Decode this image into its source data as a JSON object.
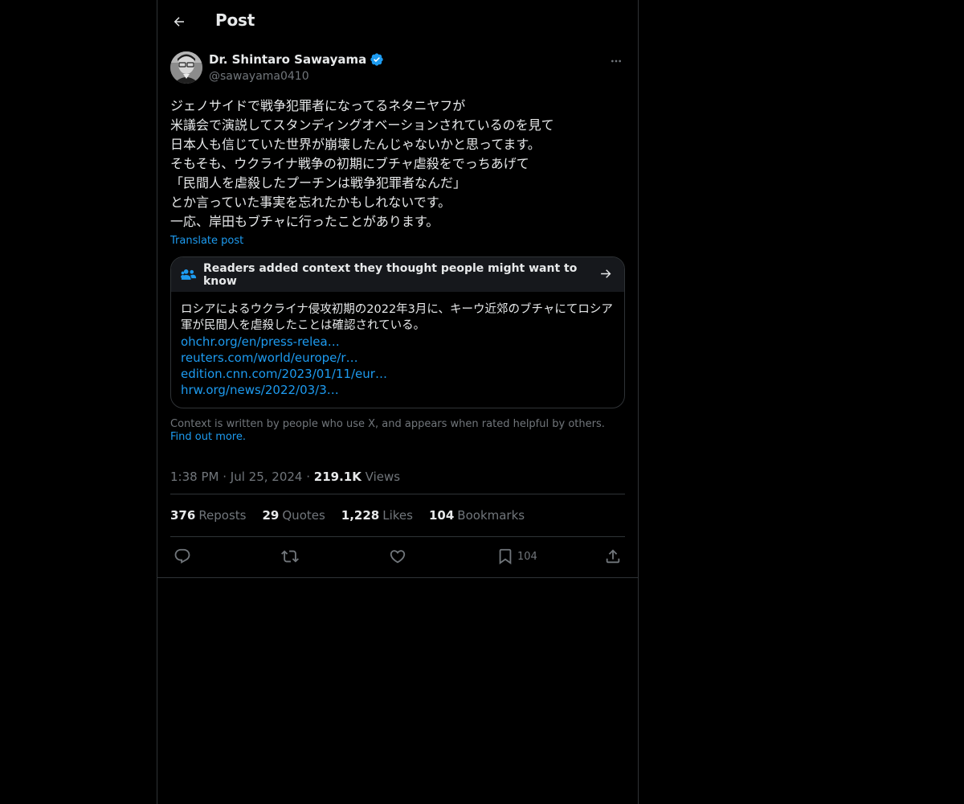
{
  "header": {
    "title": "Post"
  },
  "author": {
    "name": "Dr. Shintaro Sawayama",
    "handle": "@sawayama0410",
    "verified": true
  },
  "post": {
    "lines": [
      "ジェノサイドで戦争犯罪者になってるネタニヤフが",
      "米議会で演説してスタンディングオベーションされているのを見て",
      "日本人も信じていた世界が崩壊したんじゃないかと思ってます。",
      "そもそも、ウクライナ戦争の初期にブチャ虐殺をでっちあげて",
      "「民間人を虐殺したプーチンは戦争犯罪者なんだ」",
      "とか言っていた事実を忘れたかもしれないです。",
      "一応、岸田もブチャに行ったことがあります。"
    ],
    "translate_label": "Translate post"
  },
  "community_note": {
    "header": "Readers added context they thought people might want to know",
    "text": "ロシアによるウクライナ侵攻初期の2022年3月に、キーウ近郊のブチャにてロシア軍が民間人を虐殺したことは確認されている。",
    "links": [
      "ohchr.org/en/press-relea…",
      "reuters.com/world/europe/r…",
      "edition.cnn.com/2023/01/11/eur…",
      "hrw.org/news/2022/03/3…"
    ],
    "footer_text": "Context is written by people who use X, and appears when rated helpful by others.",
    "footer_link": "Find out more."
  },
  "meta": {
    "time": "1:38 PM",
    "date": "Jul 25, 2024",
    "views_count": "219.1K",
    "views_label": "Views"
  },
  "stats": {
    "reposts": {
      "count": "376",
      "label": "Reposts"
    },
    "quotes": {
      "count": "29",
      "label": "Quotes"
    },
    "likes": {
      "count": "1,228",
      "label": "Likes"
    },
    "bookmarks": {
      "count": "104",
      "label": "Bookmarks"
    }
  },
  "actions": {
    "bookmark_count": "104"
  },
  "colors": {
    "background": "#000000",
    "text": "#e7e9ea",
    "muted": "#71767b",
    "link": "#1d9bf0",
    "border": "#2f3336",
    "verified": "#1d9bf0"
  },
  "icons": {
    "back": "arrow-left-icon",
    "verified": "verified-badge-icon",
    "more": "more-horizontal-icon",
    "note": "people-icon",
    "note_arrow": "arrow-right-icon",
    "reply": "reply-icon",
    "repost": "repost-icon",
    "like": "heart-icon",
    "bookmark": "bookmark-icon",
    "share": "share-icon"
  }
}
